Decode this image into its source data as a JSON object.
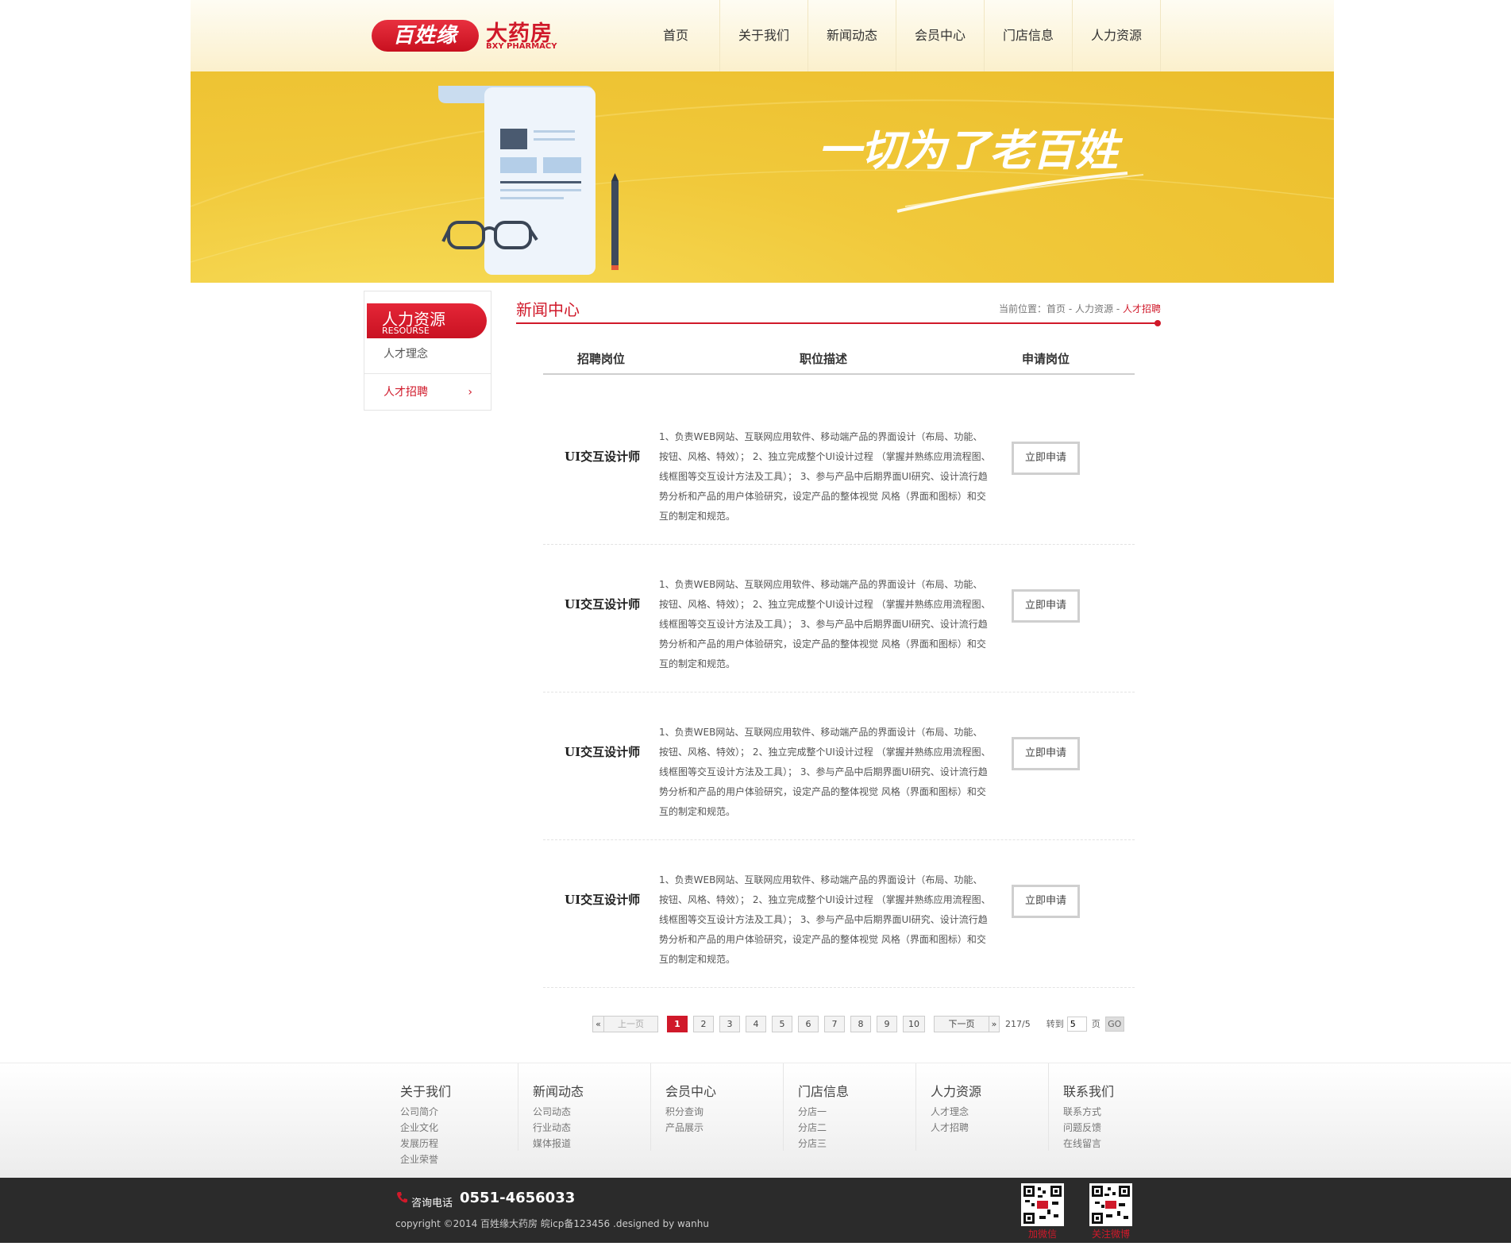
{
  "header": {
    "logo": {
      "pill": "百姓缘",
      "cn": "大药房",
      "en": "BXY PHARMACY"
    },
    "nav": [
      "首页",
      "关于我们",
      "新闻动态",
      "会员中心",
      "门店信息",
      "人力资源"
    ]
  },
  "banner": {
    "slogan": "一切为了老百姓"
  },
  "sidebar": {
    "title": "人力资源",
    "subtitle": "RESOURSE",
    "items": [
      {
        "label": "人才理念"
      },
      {
        "label": "人才招聘",
        "arrow": "›"
      }
    ]
  },
  "content": {
    "title": "新闻中心",
    "breadcrumb": {
      "prefix": "当前位置：首页 - 人力资源 -",
      "current": "人才招聘"
    }
  },
  "table": {
    "headers": [
      "招聘岗位",
      "职位描述",
      "申请岗位"
    ],
    "rows": [
      {
        "title": "UI交互设计师",
        "desc": "1、负责WEB网站、互联网应用软件、移动端产品的界面设计（布局、功能、按钮、风格、特效）； 2、独立完成整个UI设计过程 （掌握并熟练应用流程图、线框图等交互设计方法及工具）； 3、参与产品中后期界面UI研究、设计流行趋势分析和产品的用户体验研究，设定产品的整体视觉 风格（界面和图标）和交互的制定和规范。",
        "button": "立即申请"
      },
      {
        "title": "UI交互设计师",
        "desc": "1、负责WEB网站、互联网应用软件、移动端产品的界面设计（布局、功能、按钮、风格、特效）； 2、独立完成整个UI设计过程 （掌握并熟练应用流程图、线框图等交互设计方法及工具）； 3、参与产品中后期界面UI研究、设计流行趋势分析和产品的用户体验研究，设定产品的整体视觉 风格（界面和图标）和交互的制定和规范。",
        "button": "立即申请"
      },
      {
        "title": "UI交互设计师",
        "desc": "1、负责WEB网站、互联网应用软件、移动端产品的界面设计（布局、功能、按钮、风格、特效）； 2、独立完成整个UI设计过程 （掌握并熟练应用流程图、线框图等交互设计方法及工具）； 3、参与产品中后期界面UI研究、设计流行趋势分析和产品的用户体验研究，设定产品的整体视觉 风格（界面和图标）和交互的制定和规范。",
        "button": "立即申请"
      },
      {
        "title": "UI交互设计师",
        "desc": "1、负责WEB网站、互联网应用软件、移动端产品的界面设计（布局、功能、按钮、风格、特效）； 2、独立完成整个UI设计过程 （掌握并熟练应用流程图、线框图等交互设计方法及工具）； 3、参与产品中后期界面UI研究、设计流行趋势分析和产品的用户体验研究，设定产品的整体视觉 风格（界面和图标）和交互的制定和规范。",
        "button": "立即申请"
      }
    ]
  },
  "pagination": {
    "first": "«",
    "prev": "上一页",
    "pages": [
      "1",
      "2",
      "3",
      "4",
      "5",
      "6",
      "7",
      "8",
      "9",
      "10"
    ],
    "current": "1",
    "next": "下一页",
    "last": "»",
    "count": "217/5",
    "goto_label": "转到",
    "goto_value": "5",
    "page_label": "页",
    "go": "GO"
  },
  "footer": {
    "columns": [
      {
        "head": "关于我们",
        "links": [
          "公司简介",
          "企业文化",
          "发展历程",
          "企业荣誉"
        ]
      },
      {
        "head": "新闻动态",
        "links": [
          "公司动态",
          "行业动态",
          "媒体报道"
        ]
      },
      {
        "head": "会员中心",
        "links": [
          "积分查询",
          "产品展示"
        ]
      },
      {
        "head": "门店信息",
        "links": [
          "分店一",
          "分店二",
          "分店三"
        ]
      },
      {
        "head": "人力资源",
        "links": [
          "人才理念",
          "人才招聘"
        ]
      },
      {
        "head": "联系我们",
        "links": [
          "联系方式",
          "问题反馈",
          "在线留言"
        ]
      }
    ],
    "phone_label": "咨询电话",
    "phone": "0551-4656033",
    "copyright": "copyright ©2014 百姓缘大药房 皖icp备123456 .designed by wanhu",
    "qr": [
      {
        "label": "加微信"
      },
      {
        "label": "关注微博"
      }
    ]
  },
  "colors": {
    "brand": "#d0192a",
    "banner": "#f1c93b",
    "footer_dark": "#2b2b2b"
  }
}
